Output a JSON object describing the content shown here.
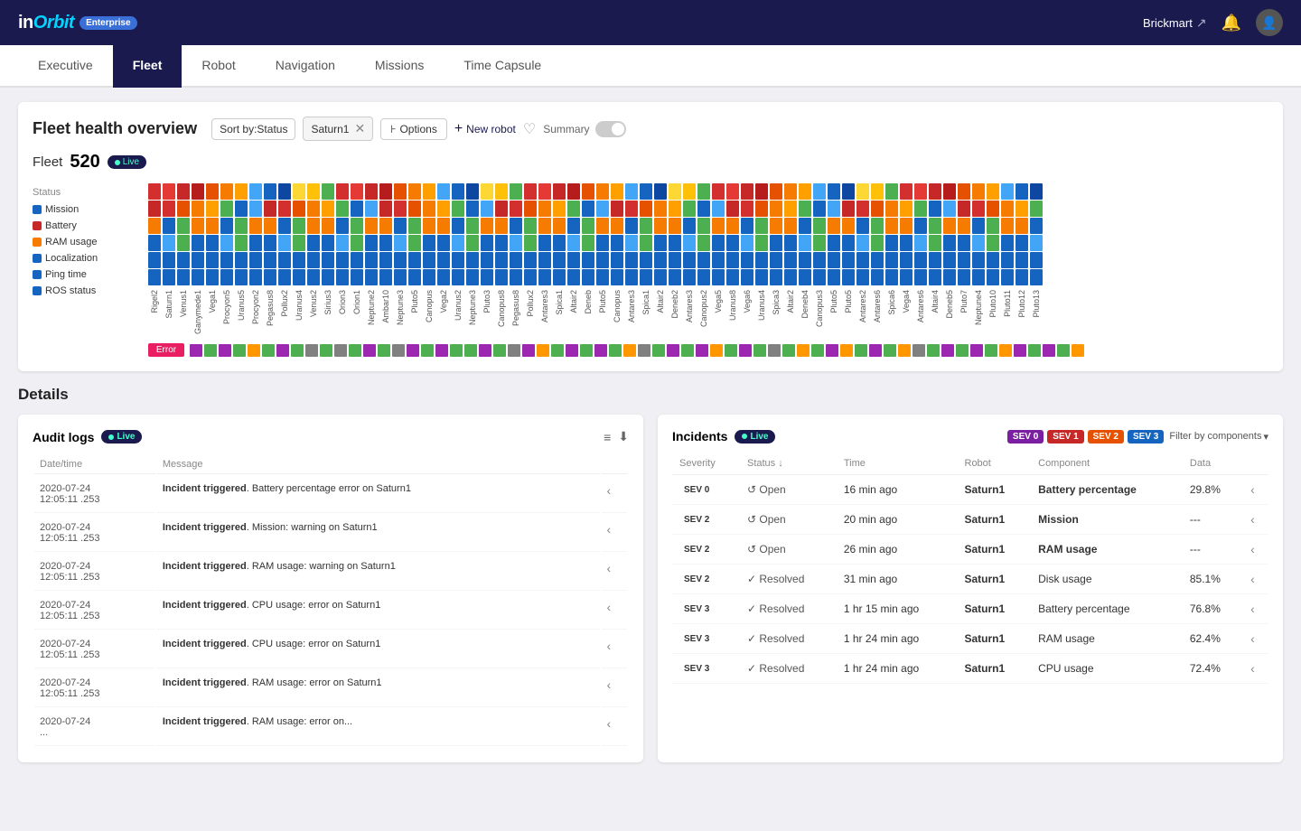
{
  "topbar": {
    "logo": "inOrbit",
    "badge": "Enterprise",
    "username": "Brickmart",
    "icons": [
      "export-icon",
      "bell-icon",
      "avatar-icon"
    ]
  },
  "tabs": [
    {
      "id": "executive",
      "label": "Executive",
      "active": false
    },
    {
      "id": "fleet",
      "label": "Fleet",
      "active": true
    },
    {
      "id": "robot",
      "label": "Robot",
      "active": false
    },
    {
      "id": "navigation",
      "label": "Navigation",
      "active": false
    },
    {
      "id": "missions",
      "label": "Missions",
      "active": false
    },
    {
      "id": "time-capsule",
      "label": "Time Capsule",
      "active": false
    }
  ],
  "fleet_health": {
    "title": "Fleet health overview",
    "filter_sort": "Sort by:Status",
    "filter_group": "Saturn1",
    "options_label": "Options",
    "new_robot_label": "New robot",
    "summary_label": "Summary",
    "fleet_label": "Fleet",
    "fleet_count": "520",
    "live_label": "Live",
    "chart_labels": [
      {
        "label": "Mission",
        "color": "#1565c0"
      },
      {
        "label": "Battery",
        "color": "#c62828"
      },
      {
        "label": "RAM usage",
        "color": "#f57c00"
      },
      {
        "label": "Localization",
        "color": "#1565c0"
      },
      {
        "label": "Ping time",
        "color": "#1565c0"
      },
      {
        "label": "ROS status",
        "color": "#1565c0"
      }
    ],
    "error_label": "Error",
    "robot_names": [
      "Rigel2",
      "Saturn1",
      "Venus1",
      "Ganymede1",
      "Vega1",
      "Procyon5",
      "Uranus5",
      "Procyon2",
      "Pegasus8",
      "Pollux2",
      "Uranus4",
      "Venus2",
      "Sirius3",
      "Orion3",
      "Orion1",
      "Neptune2",
      "Ambar10",
      "Neptune3",
      "Pluto5",
      "Canopus",
      "Vega2",
      "Uranus2",
      "Neptune3",
      "Pluto3",
      "Canopus8",
      "Pegasus8",
      "Pollux2",
      "Antares3",
      "Spica1",
      "Altair2",
      "Deneb",
      "Pluto5",
      "Canopus",
      "Antares3",
      "Spica1",
      "Altair2",
      "Deneb2",
      "Antares3",
      "Canopus2",
      "Vega5",
      "Uranus8",
      "Vega6",
      "Uranus4",
      "Spica3",
      "Altair2",
      "Deneb4",
      "Canopus3",
      "Pluto5",
      "Pluto5",
      "Antares2",
      "Antares6",
      "Spica6",
      "Vega4",
      "Antares6",
      "Altair4",
      "Deneb5",
      "Pluto7",
      "Neptune4",
      "Pluto10",
      "Pluto11",
      "Pluto12",
      "Pluto13"
    ]
  },
  "details": {
    "title": "Details",
    "audit_logs": {
      "title": "Audit logs",
      "live_label": "Live",
      "columns": [
        "Date/time",
        "Message"
      ],
      "rows": [
        {
          "datetime": "2020-07-24\n12:05:11 .253",
          "message": "Incident triggered. Battery percentage error on Saturn1"
        },
        {
          "datetime": "2020-07-24\n12:05:11 .253",
          "message": "Incident triggered. Mission: warning on Saturn1"
        },
        {
          "datetime": "2020-07-24\n12:05:11 .253",
          "message": "Incident triggered. RAM usage: warning on Saturn1"
        },
        {
          "datetime": "2020-07-24\n12:05:11 .253",
          "message": "Incident triggered. CPU usage: error on Saturn1"
        },
        {
          "datetime": "2020-07-24\n12:05:11 .253",
          "message": "Incident triggered. CPU usage: error on Saturn1"
        },
        {
          "datetime": "2020-07-24\n12:05:11 .253",
          "message": "Incident triggered. RAM usage: error on Saturn1"
        },
        {
          "datetime": "2020-07-24\n...",
          "message": "Incident triggered. RAM usage: error on..."
        }
      ]
    },
    "incidents": {
      "title": "Incidents",
      "live_label": "Live",
      "sev_filters": [
        "SEV 0",
        "SEV 1",
        "SEV 2",
        "SEV 3"
      ],
      "filter_components_label": "Filter by components",
      "columns": [
        "Severity",
        "Status",
        "Time",
        "Robot",
        "Component",
        "Data"
      ],
      "rows": [
        {
          "sev": "SEV 0",
          "sev_class": "sev0",
          "status": "Open",
          "status_type": "open",
          "time": "16 min ago",
          "robot": "Saturn1",
          "component": "Battery percentage",
          "data": "29.8%"
        },
        {
          "sev": "SEV 2",
          "sev_class": "sev2",
          "status": "Open",
          "status_type": "open",
          "time": "20 min ago",
          "robot": "Saturn1",
          "component": "Mission",
          "data": "---"
        },
        {
          "sev": "SEV 2",
          "sev_class": "sev2",
          "status": "Open",
          "status_type": "open",
          "time": "26 min ago",
          "robot": "Saturn1",
          "component": "RAM usage",
          "data": "---"
        },
        {
          "sev": "SEV 2",
          "sev_class": "sev2",
          "status": "Resolved",
          "status_type": "resolved",
          "time": "31 min ago",
          "robot": "Saturn1",
          "component": "Disk usage",
          "data": "85.1%"
        },
        {
          "sev": "SEV 3",
          "sev_class": "sev3",
          "status": "Resolved",
          "status_type": "resolved",
          "time": "1 hr 15 min ago",
          "robot": "Saturn1",
          "component": "Battery percentage",
          "data": "76.8%"
        },
        {
          "sev": "SEV 3",
          "sev_class": "sev3",
          "status": "Resolved",
          "status_type": "resolved",
          "time": "1 hr 24 min ago",
          "robot": "Saturn1",
          "component": "RAM usage",
          "data": "62.4%"
        },
        {
          "sev": "SEV 3",
          "sev_class": "sev3",
          "status": "Resolved",
          "status_type": "resolved",
          "time": "1 hr 24 min ago",
          "robot": "Saturn1",
          "component": "CPU usage",
          "data": "72.4%"
        }
      ]
    }
  }
}
